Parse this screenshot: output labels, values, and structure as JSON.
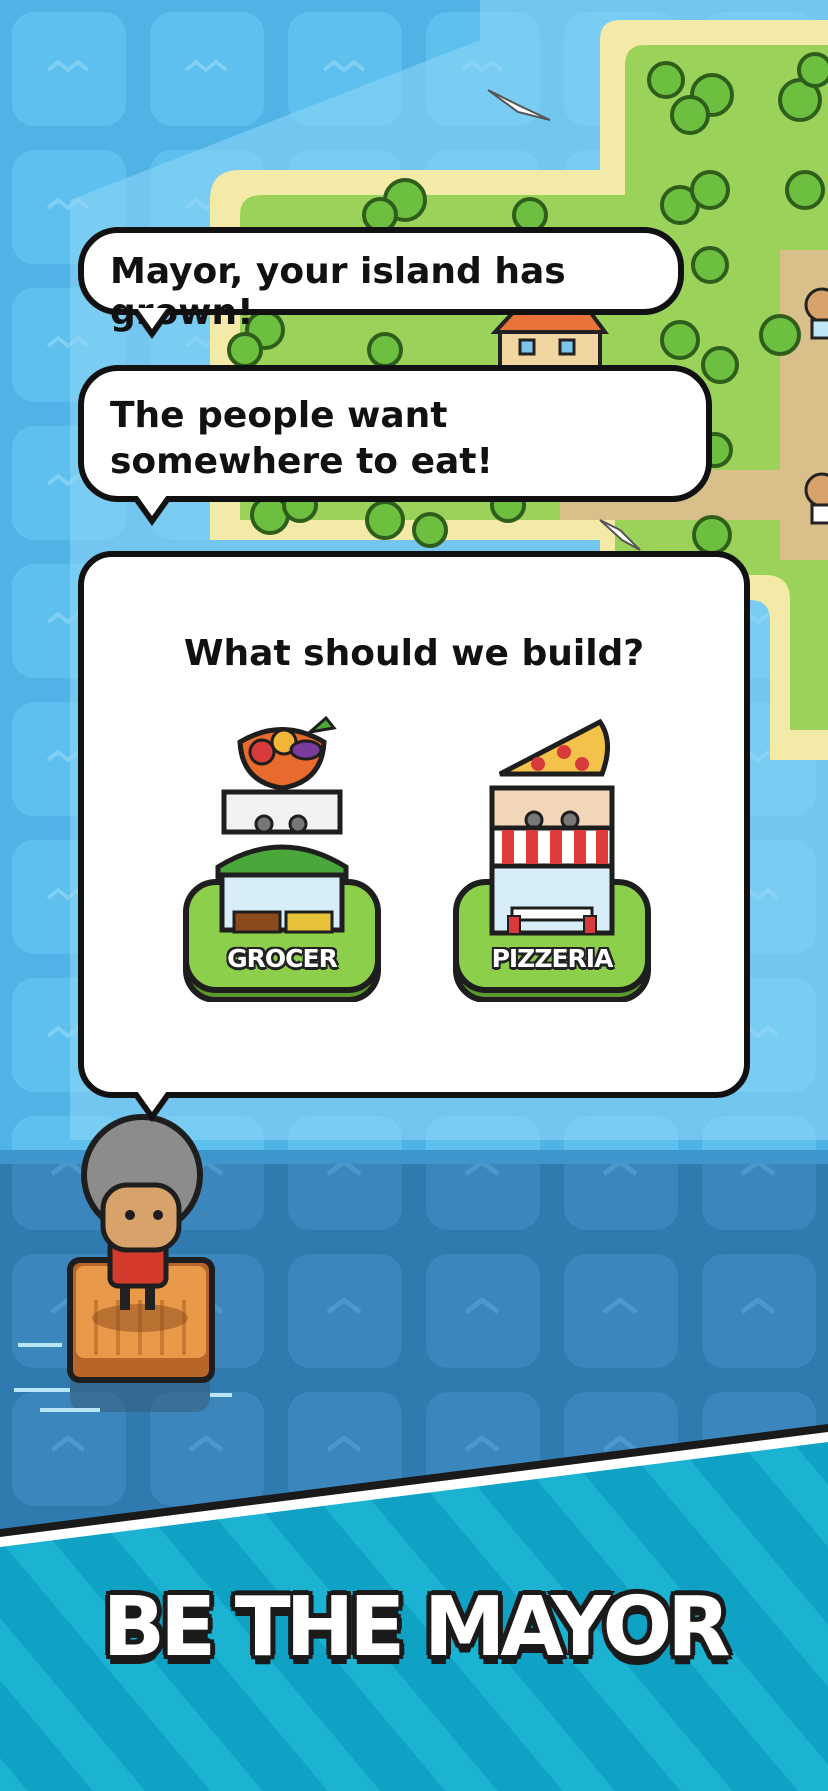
{
  "dialog": {
    "line1": "Mayor, your island has grown!",
    "line2": "The people want somewhere to eat!",
    "question": "What should we build?"
  },
  "options": [
    {
      "label": "GROCER",
      "icon": "grocer-building-icon"
    },
    {
      "label": "PIZZERIA",
      "icon": "pizzeria-building-icon"
    }
  ],
  "banner": {
    "text": "BE THE MAYOR"
  },
  "colors": {
    "water": "#4fb3e6",
    "deep_water": "#2f7bb0",
    "grass": "#9bd35a",
    "sand": "#f3e9a6",
    "tile_green": "#7fc84a",
    "banner_bg": "#12a8c8"
  }
}
